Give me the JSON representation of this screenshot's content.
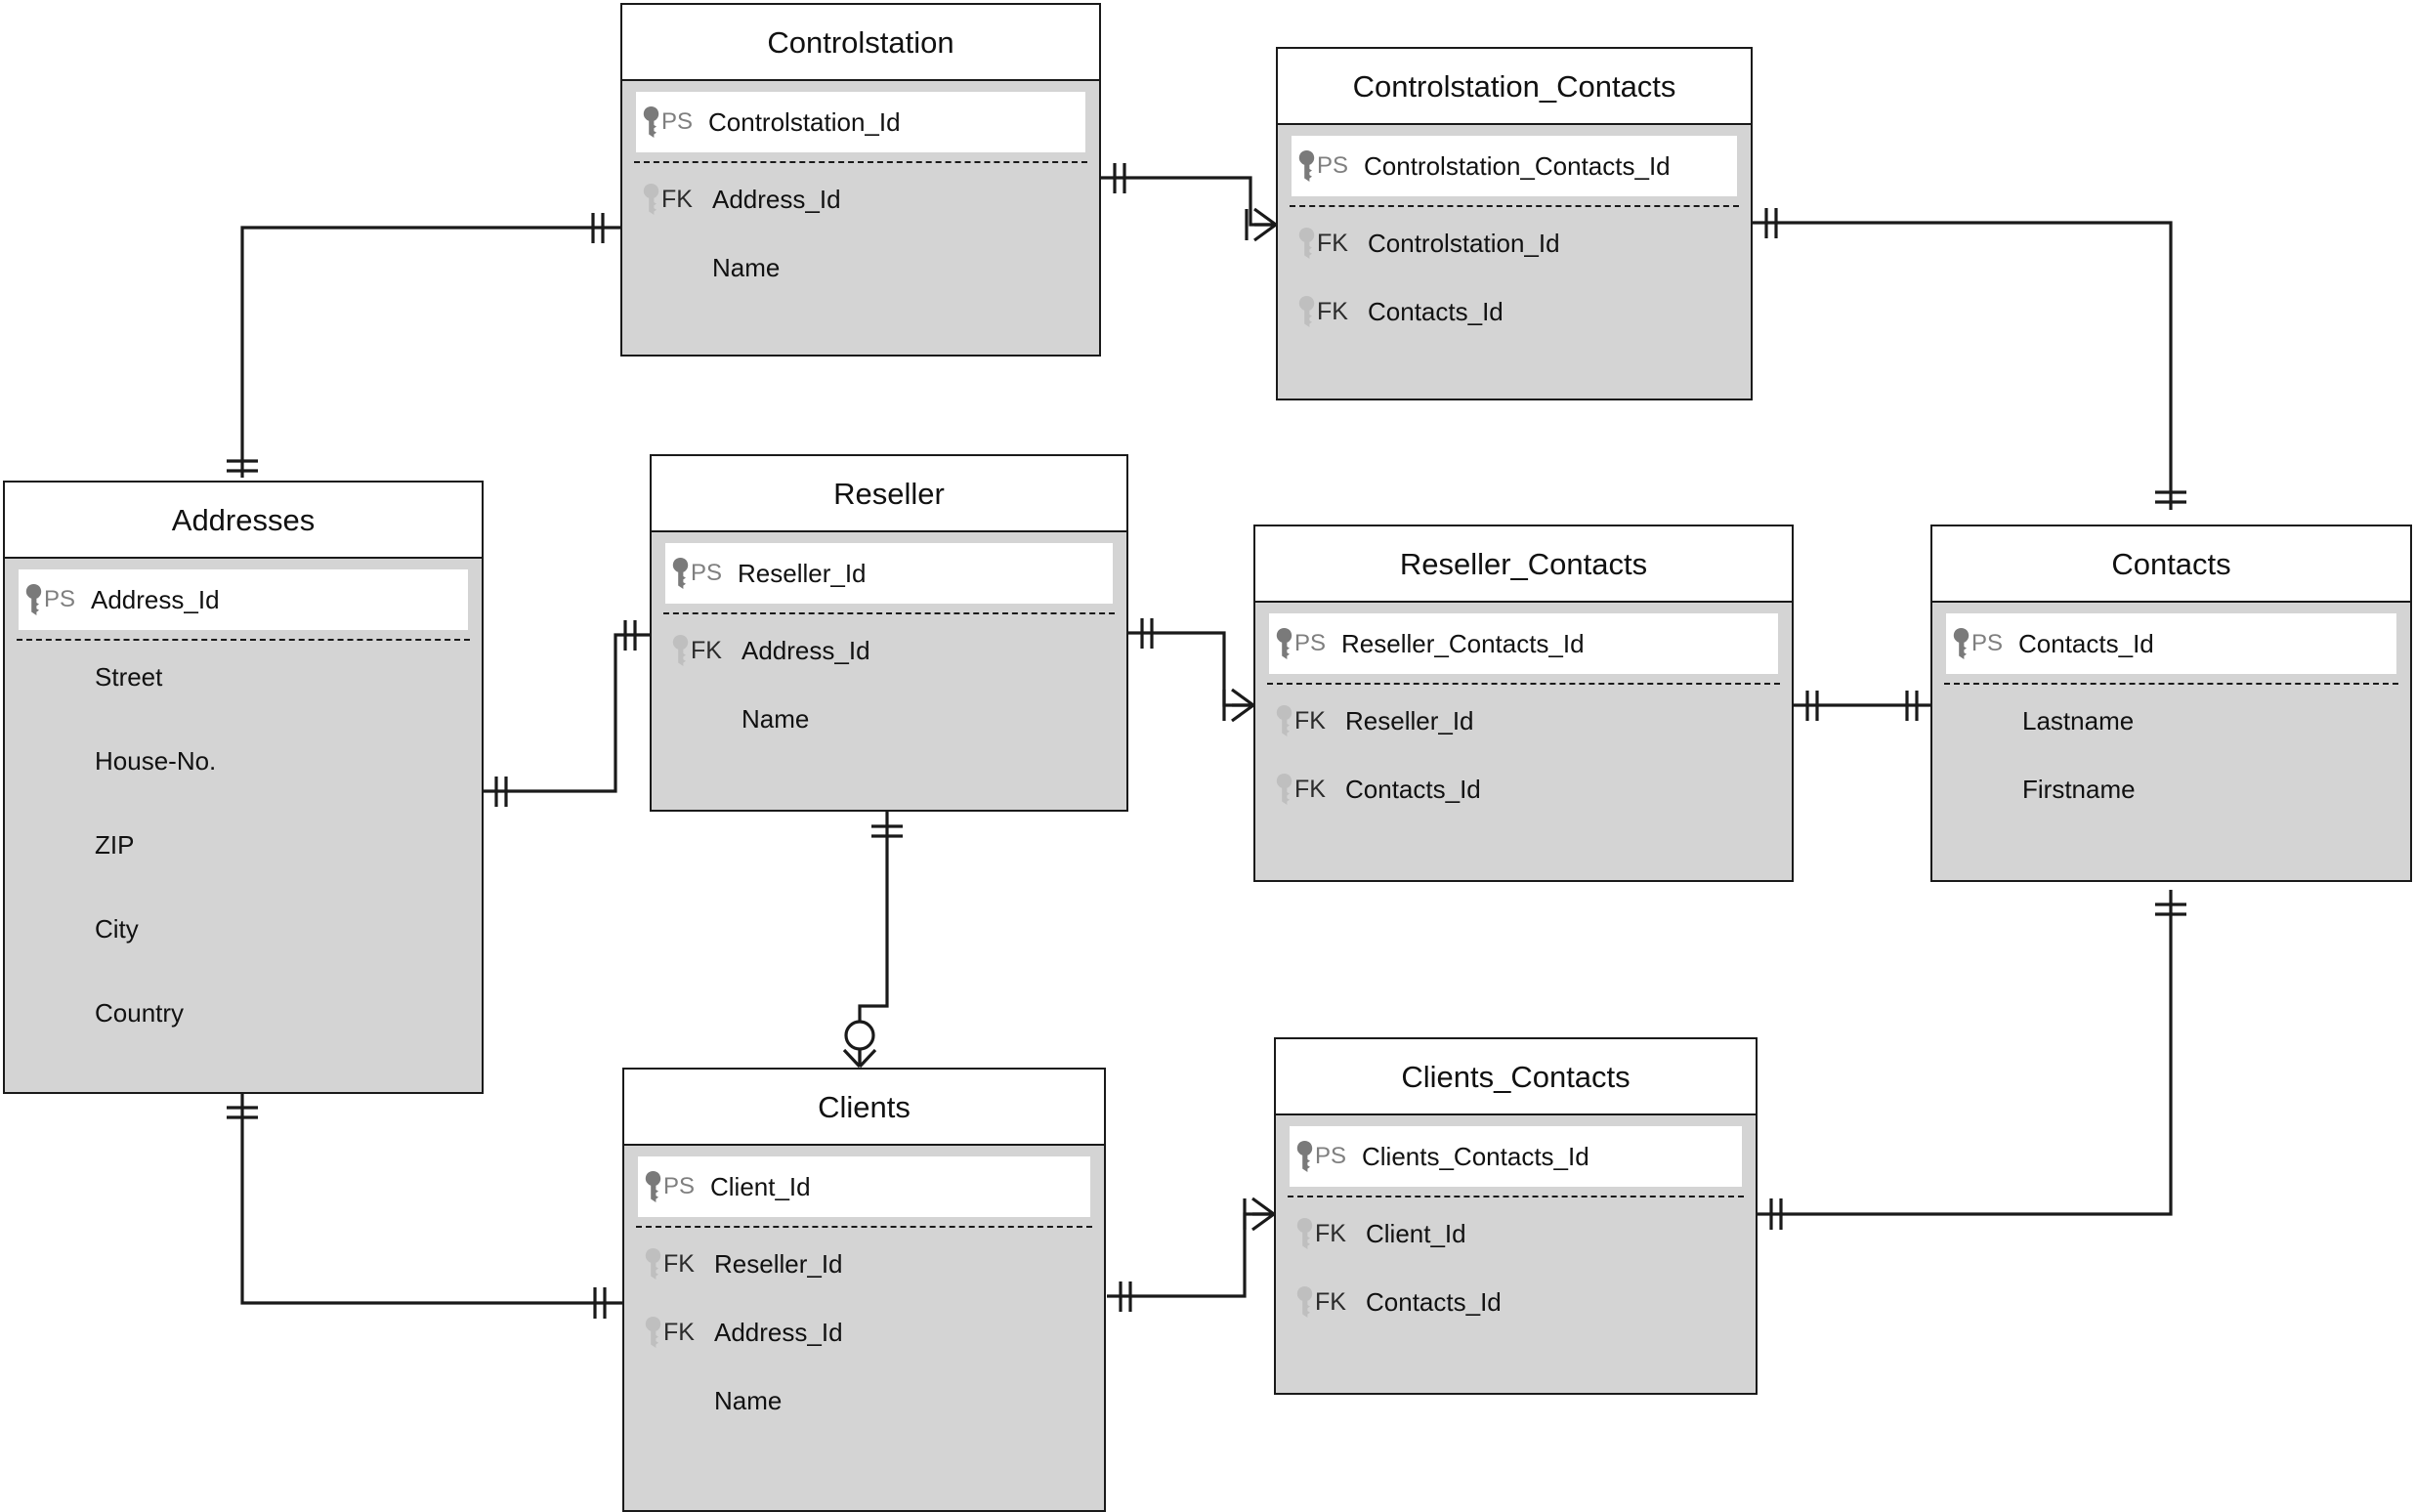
{
  "diagram": {
    "type": "entity-relationship-diagram",
    "notation": "crows-foot",
    "colors": {
      "entity_border": "#1a1a1a",
      "entity_body_fill": "#d4d4d4",
      "entity_header_fill": "#ffffff",
      "pk_block_fill": "#ffffff",
      "pk_tag_text": "#7f7f7f",
      "fk_tag_text": "#2b2b2b",
      "attribute_text": "#111111",
      "connector": "#1a1a1a",
      "canvas": "#ffffff"
    },
    "entities": [
      {
        "id": "controlstation",
        "name": "Controlstation",
        "pk": {
          "tag": "PS",
          "icon": "key-icon",
          "label": "Controlstation_Id"
        },
        "attributes": [
          {
            "tag": "FK",
            "icon": "key-icon",
            "label": "Address_Id"
          },
          {
            "tag": "",
            "icon": "",
            "label": "Name"
          }
        ]
      },
      {
        "id": "controlstation_contacts",
        "name": "Controlstation_Contacts",
        "pk": {
          "tag": "PS",
          "icon": "key-icon",
          "label": "Controlstation_Contacts_Id"
        },
        "attributes": [
          {
            "tag": "FK",
            "icon": "key-icon",
            "label": "Controlstation_Id"
          },
          {
            "tag": "FK",
            "icon": "key-icon",
            "label": "Contacts_Id"
          }
        ]
      },
      {
        "id": "addresses",
        "name": "Addresses",
        "pk": {
          "tag": "PS",
          "icon": "key-icon",
          "label": "Address_Id"
        },
        "attributes": [
          {
            "tag": "",
            "icon": "",
            "label": "Street"
          },
          {
            "tag": "",
            "icon": "",
            "label": "House-No."
          },
          {
            "tag": "",
            "icon": "",
            "label": "ZIP"
          },
          {
            "tag": "",
            "icon": "",
            "label": "City"
          },
          {
            "tag": "",
            "icon": "",
            "label": "Country"
          }
        ]
      },
      {
        "id": "reseller",
        "name": "Reseller",
        "pk": {
          "tag": "PS",
          "icon": "key-icon",
          "label": "Reseller_Id"
        },
        "attributes": [
          {
            "tag": "FK",
            "icon": "key-icon",
            "label": "Address_Id"
          },
          {
            "tag": "",
            "icon": "",
            "label": "Name"
          }
        ]
      },
      {
        "id": "reseller_contacts",
        "name": "Reseller_Contacts",
        "pk": {
          "tag": "PS",
          "icon": "key-icon",
          "label": "Reseller_Contacts_Id"
        },
        "attributes": [
          {
            "tag": "FK",
            "icon": "key-icon",
            "label": "Reseller_Id"
          },
          {
            "tag": "FK",
            "icon": "key-icon",
            "label": "Contacts_Id"
          }
        ]
      },
      {
        "id": "contacts",
        "name": "Contacts",
        "pk": {
          "tag": "PS",
          "icon": "key-icon",
          "label": "Contacts_Id"
        },
        "attributes": [
          {
            "tag": "",
            "icon": "",
            "label": "Lastname"
          },
          {
            "tag": "",
            "icon": "",
            "label": "Firstname"
          }
        ]
      },
      {
        "id": "clients",
        "name": "Clients",
        "pk": {
          "tag": "PS",
          "icon": "key-icon",
          "label": "Client_Id"
        },
        "attributes": [
          {
            "tag": "FK",
            "icon": "key-icon",
            "label": "Reseller_Id"
          },
          {
            "tag": "FK",
            "icon": "key-icon",
            "label": "Address_Id"
          },
          {
            "tag": "",
            "icon": "",
            "label": "Name"
          }
        ]
      },
      {
        "id": "clients_contacts",
        "name": "Clients_Contacts",
        "pk": {
          "tag": "PS",
          "icon": "key-icon",
          "label": "Clients_Contacts_Id"
        },
        "attributes": [
          {
            "tag": "FK",
            "icon": "key-icon",
            "label": "Client_Id"
          },
          {
            "tag": "FK",
            "icon": "key-icon",
            "label": "Contacts_Id"
          }
        ]
      }
    ],
    "relationships": [
      {
        "from": "addresses",
        "to": "controlstation",
        "from_cardinality": "one-and-only-one",
        "to_cardinality": "one-and-only-one"
      },
      {
        "from": "controlstation",
        "to": "controlstation_contacts",
        "from_cardinality": "one-and-only-one",
        "to_cardinality": "one-or-many"
      },
      {
        "from": "controlstation_contacts",
        "to": "contacts",
        "from_cardinality": "one-and-only-one",
        "to_cardinality": "one-and-only-one"
      },
      {
        "from": "addresses",
        "to": "reseller",
        "from_cardinality": "one-and-only-one",
        "to_cardinality": "one-and-only-one"
      },
      {
        "from": "reseller",
        "to": "reseller_contacts",
        "from_cardinality": "one-and-only-one",
        "to_cardinality": "one-or-many"
      },
      {
        "from": "reseller_contacts",
        "to": "contacts",
        "from_cardinality": "one-and-only-one",
        "to_cardinality": "one-and-only-one"
      },
      {
        "from": "reseller",
        "to": "clients",
        "from_cardinality": "one-and-only-one",
        "to_cardinality": "zero-or-many"
      },
      {
        "from": "addresses",
        "to": "clients",
        "from_cardinality": "one-and-only-one",
        "to_cardinality": "one-and-only-one"
      },
      {
        "from": "clients",
        "to": "clients_contacts",
        "from_cardinality": "one-and-only-one",
        "to_cardinality": "one-or-many"
      },
      {
        "from": "contacts",
        "to": "clients_contacts",
        "from_cardinality": "one-and-only-one",
        "to_cardinality": "one-and-only-one"
      }
    ]
  }
}
